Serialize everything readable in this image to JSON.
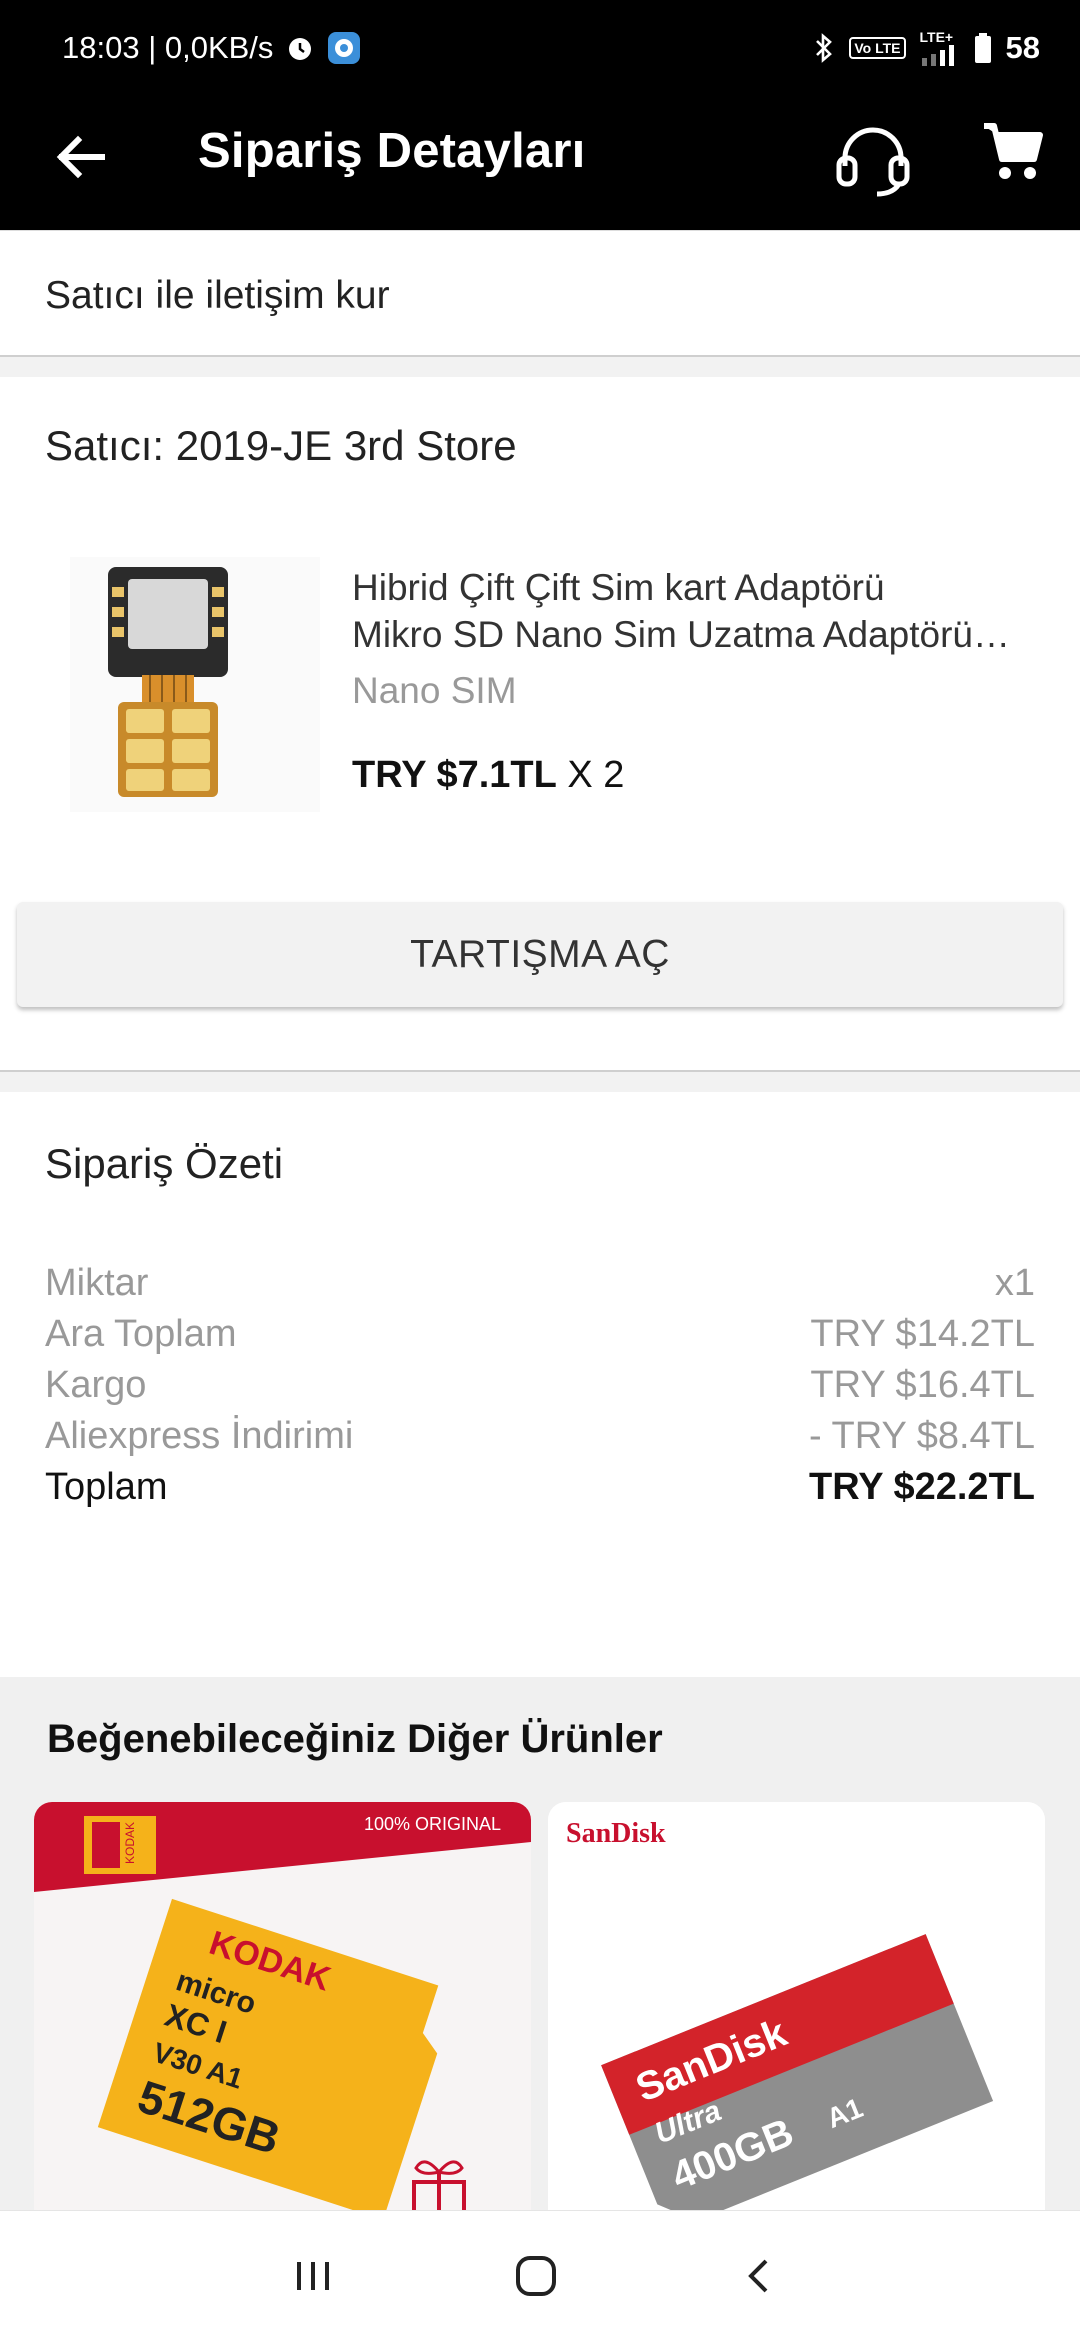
{
  "status_bar": {
    "time_speed": "18:03 | 0,0KB/s",
    "alarm_icon": "alarm-icon",
    "app_icon": "app-notification-icon",
    "bluetooth_icon": "bluetooth-icon",
    "volte_label": "Vo LTE",
    "lte_label": "LTE+",
    "signal_icon": "signal-icon",
    "battery_icon": "battery-icon",
    "battery_level": "58"
  },
  "app_bar": {
    "title": "Sipariş Detayları",
    "back_icon": "back-arrow-icon",
    "support_icon": "headset-icon",
    "cart_icon": "cart-icon"
  },
  "contact": {
    "label": "Satıcı ile iletişim kur"
  },
  "seller": {
    "name": "Satıcı: 2019-JE 3rd Store",
    "product": {
      "title_line1": "Hibrid Çift Çift Sim kart Adaptörü",
      "title_line2": "Mikro SD Nano Sim Uzatma Adaptörü…",
      "variant": "Nano SIM",
      "price": "TRY $7.1TL",
      "quantity": "X 2"
    },
    "dispute_label": "TARTIŞMA AÇ"
  },
  "summary": {
    "title": "Sipariş Özeti",
    "rows": [
      {
        "label": "Miktar",
        "value": "x1"
      },
      {
        "label": "Ara Toplam",
        "value": "TRY $14.2TL"
      },
      {
        "label": "Kargo",
        "value": "TRY $16.4TL"
      },
      {
        "label": "Aliexpress İndirimi",
        "value": "- TRY $8.4TL"
      }
    ],
    "total_label": "Toplam",
    "total_value": "TRY $22.2TL"
  },
  "recommendations": {
    "title": "Beğenebileceğiniz Diğer Ürünler",
    "cards": [
      {
        "badge": "100% ORIGINAL",
        "brand": "KODAK",
        "brand_side": "KODAK",
        "card_line1": "micro",
        "card_line2": "XC I",
        "card_speed": "V30 A1",
        "capacity": "512GB"
      },
      {
        "brand": "SanDisk",
        "card_brand": "SanDisk",
        "card_line": "Ultra",
        "capacity": "400GB",
        "card_class": "A1"
      }
    ]
  },
  "nav_bar": {
    "recents_icon": "recents-icon",
    "home_icon": "home-icon",
    "back_icon": "back-chevron-icon"
  },
  "colors": {
    "bar_background": "#000000",
    "divider": "#f2f2f2",
    "muted_text": "#999999",
    "kodak_red": "#c8102e",
    "kodak_yellow": "#f5b21a",
    "sandisk_red": "#d3232a"
  }
}
